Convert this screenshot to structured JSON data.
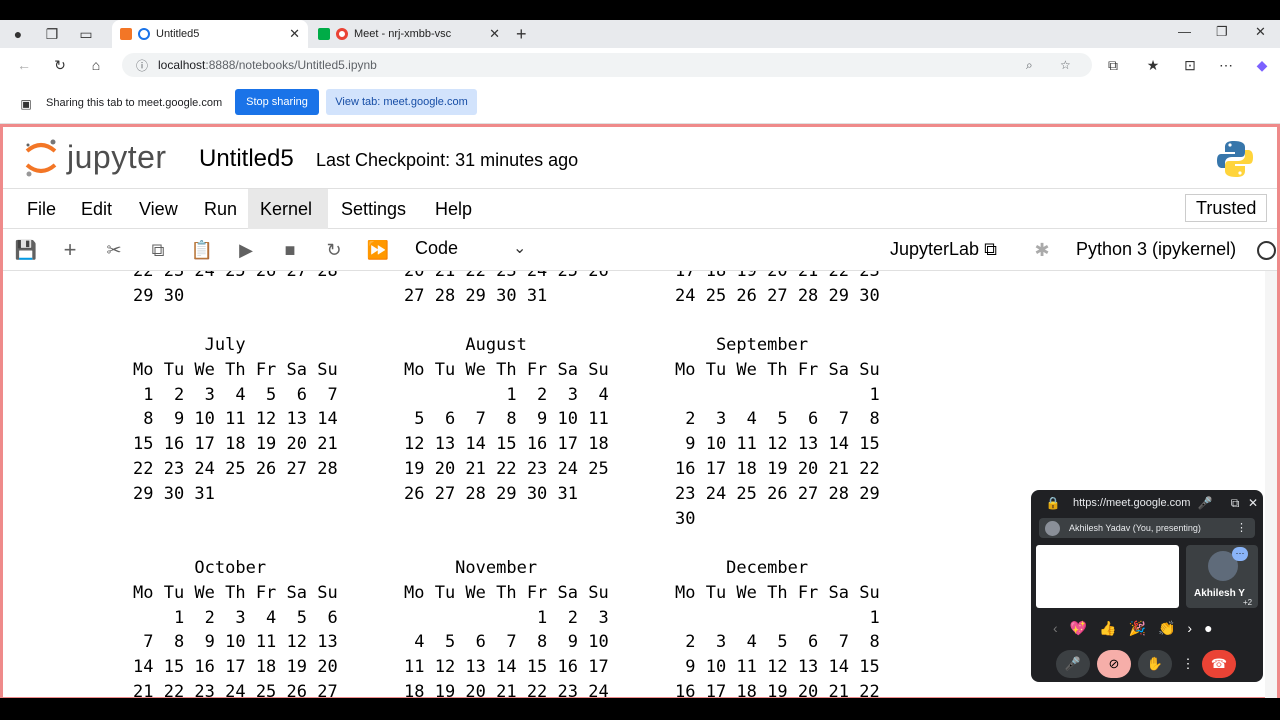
{
  "browser": {
    "tabs": [
      {
        "title": "Untitled5",
        "active": true
      },
      {
        "title": "Meet - nrj-xmbb-vsc",
        "active": false
      }
    ],
    "address_host": "localhost",
    "address_path": ":8888/notebooks/Untitled5.ipynb",
    "share_message": "Sharing this tab to meet.google.com",
    "stop_sharing": "Stop sharing",
    "view_tab": "View tab: meet.google.com"
  },
  "jupyter": {
    "logo_text": "jupyter",
    "notebook_title": "Untitled5",
    "checkpoint": "Last Checkpoint: 31 minutes ago",
    "menu": [
      "File",
      "Edit",
      "View",
      "Run",
      "Kernel",
      "Settings",
      "Help"
    ],
    "trusted": "Trusted",
    "cell_type": "Code",
    "jupyterlab_link": "JupyterLab",
    "kernel_name": "Python 3 (ipykernel)"
  },
  "calendar": {
    "partial_top": {
      "col1": "22 23 24 25 26 27 28\n29 30",
      "col2": "20 21 22 23 24 25 26\n27 28 29 30 31",
      "col3": "17 18 19 20 21 22 23\n24 25 26 27 28 29 30"
    },
    "row1": {
      "col1": "       July\nMo Tu We Th Fr Sa Su\n 1  2  3  4  5  6  7\n 8  9 10 11 12 13 14\n15 16 17 18 19 20 21\n22 23 24 25 26 27 28\n29 30 31",
      "col2": "      August\nMo Tu We Th Fr Sa Su\n          1  2  3  4\n 5  6  7  8  9 10 11\n12 13 14 15 16 17 18\n19 20 21 22 23 24 25\n26 27 28 29 30 31",
      "col3": "    September\nMo Tu We Th Fr Sa Su\n                   1\n 2  3  4  5  6  7  8\n 9 10 11 12 13 14 15\n16 17 18 19 20 21 22\n23 24 25 26 27 28 29\n30"
    },
    "row2": {
      "col1": "      October\nMo Tu We Th Fr Sa Su\n    1  2  3  4  5  6\n 7  8  9 10 11 12 13\n14 15 16 17 18 19 20\n21 22 23 24 25 26 27",
      "col2": "     November\nMo Tu We Th Fr Sa Su\n             1  2  3\n 4  5  6  7  8  9 10\n11 12 13 14 15 16 17\n18 19 20 21 22 23 24",
      "col3": "     December\nMo Tu We Th Fr Sa Su\n                   1\n 2  3  4  5  6  7  8\n 9 10 11 12 13 14 15\n16 17 18 19 20 21 22"
    }
  },
  "meet": {
    "url": "https://meet.google.com",
    "presenter": "Akhilesh Yadav (You, presenting)",
    "participant": "Akhilesh Y",
    "extra": "+2",
    "reactions": [
      "💖",
      "👍",
      "🎉",
      "👏"
    ]
  }
}
